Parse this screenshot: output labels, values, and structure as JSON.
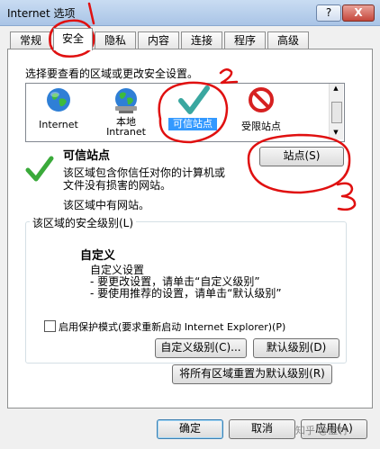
{
  "window": {
    "title": "Internet 选项",
    "help_label": "?",
    "close_label": "X"
  },
  "tabs": [
    "常规",
    "安全",
    "隐私",
    "内容",
    "连接",
    "程序",
    "高级"
  ],
  "security": {
    "select_zone_prompt": "选择要查看的区域或更改安全设置。",
    "zones": [
      {
        "label": "Internet",
        "icon": "globe-icon"
      },
      {
        "label": "本地 Intranet",
        "line1": "本地",
        "line2": "Intranet",
        "icon": "intranet-globe-icon"
      },
      {
        "label": "可信站点",
        "icon": "check-mark-icon",
        "selected": true
      },
      {
        "label": "受限站点",
        "icon": "restricted-icon"
      }
    ],
    "zone_title": "可信站点",
    "zone_desc_line1": "该区域包含你信任对你的计算机或",
    "zone_desc_line2": "文件没有损害的网站。",
    "zone_has_sites": "该区域中有网站。",
    "sites_button": "站点(S)",
    "level_group_label": "该区域的安全级别(L)",
    "level_name": "自定义",
    "level_desc_1": "自定义设置",
    "level_desc_2": "- 要更改设置，请单击“自定义级别”",
    "level_desc_3": "- 要使用推荐的设置，请单击“默认级别”",
    "protected_mode_label": "启用保护模式(要求重新启动 Internet Explorer)(P)",
    "protected_mode_checked": false,
    "custom_level_button": "自定义级别(C)...",
    "default_level_button": "默认级别(D)",
    "reset_all_button": "将所有区域重置为默认级别(R)"
  },
  "footer": {
    "ok": "确定",
    "cancel": "取消",
    "apply": "应用(A)",
    "watermark": "知乎 @虚竹"
  },
  "annotations": [
    "1",
    "2",
    "3"
  ],
  "colors": {
    "selection": "#3399ff",
    "annotation_red": "#e01010",
    "titlebar": "#b9d1ee",
    "check_green": "#3aaa3a"
  }
}
